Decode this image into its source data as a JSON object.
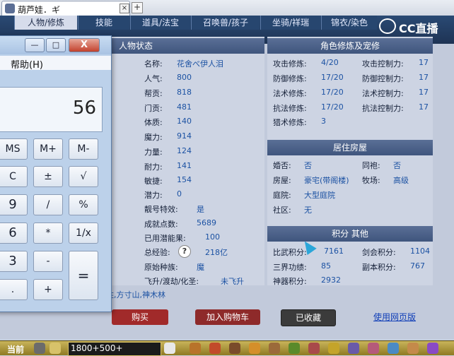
{
  "browser": {
    "tab_title": "葫芦娃．ギ",
    "close_symbol": "×",
    "new_tab_symbol": "+"
  },
  "game": {
    "tabs": [
      "人物/修炼",
      "技能",
      "道具/法宝",
      "召唤兽/孩子",
      "坐骑/祥瑞",
      "锦衣/染色"
    ],
    "logo_text": "CC直播",
    "status": {
      "header": "人物状态",
      "rows": [
        {
          "label": "名称:",
          "value": "花舍べ伊人泪"
        },
        {
          "label": "人气:",
          "value": "800"
        },
        {
          "label": "帮贡:",
          "value": "818"
        },
        {
          "label": "门贡:",
          "value": "481"
        },
        {
          "label": "体质:",
          "value": "140"
        },
        {
          "label": "魔力:",
          "value": "914"
        },
        {
          "label": "力量:",
          "value": "124"
        },
        {
          "label": "耐力:",
          "value": "141"
        },
        {
          "label": "敏捷:",
          "value": "154"
        },
        {
          "label": "潜力:",
          "value": "0"
        },
        {
          "label": "靓号特效:",
          "value": "是"
        },
        {
          "label": "成就点数:",
          "value": "5689"
        },
        {
          "label": "已用潜能果:",
          "value": "100"
        },
        {
          "label": "总经验:",
          "value": "218亿"
        },
        {
          "label": "原始种族:",
          "value": "魔"
        },
        {
          "label": "飞升/渡劫/化圣:",
          "value": "未飞升"
        }
      ],
      "footer": "胜,方寸山,神木林",
      "help_symbol": "?"
    },
    "practice": {
      "header": "角色修炼及宠修",
      "rows": [
        {
          "l1": "攻击修炼:",
          "v1": "4/20",
          "l2": "攻击控制力:",
          "v2": "17"
        },
        {
          "l1": "防御修炼:",
          "v1": "17/20",
          "l2": "防御控制力:",
          "v2": "17"
        },
        {
          "l1": "法术修炼:",
          "v1": "17/20",
          "l2": "法术控制力:",
          "v2": "17"
        },
        {
          "l1": "抗法修炼:",
          "v1": "17/20",
          "l2": "抗法控制力:",
          "v2": "17"
        },
        {
          "l1": "猎术修炼:",
          "v1": "3",
          "l2": "",
          "v2": ""
        }
      ]
    },
    "house": {
      "header": "居住房屋",
      "rows": [
        {
          "l1": "婚否:",
          "v1": "否",
          "l2": "同袍:",
          "v2": "否"
        },
        {
          "l1": "房屋:",
          "v1": "豪宅(带阁楼)",
          "l2": "牧场:",
          "v2": "高级"
        },
        {
          "l1": "庭院:",
          "v1": "大型庭院",
          "l2": "",
          "v2": ""
        },
        {
          "l1": "社区:",
          "v1": "无",
          "l2": "",
          "v2": ""
        }
      ]
    },
    "points": {
      "header": "积分 其他",
      "rows": [
        {
          "l1": "比武积分:",
          "v1": "7161",
          "l2": "剑会积分:",
          "v2": "1104"
        },
        {
          "l1": "三界功绩:",
          "v1": "85",
          "l2": "副本积分:",
          "v2": "767"
        },
        {
          "l1": "神器积分:",
          "v1": "2932",
          "l2": "",
          "v2": ""
        }
      ]
    },
    "buttons": {
      "buy": "购买",
      "cart": "加入购物车",
      "fav": "已收藏",
      "web": "使用网页版"
    }
  },
  "calculator": {
    "menu_help": "帮助(H)",
    "menu_left": ")",
    "display": "56",
    "min_symbol": "—",
    "max_symbol": "□",
    "close_symbol": "X",
    "keys": [
      [
        "MS",
        "M+",
        "M-"
      ],
      [
        "C",
        "±",
        "√"
      ],
      [
        "9",
        "/",
        "%"
      ],
      [
        "6",
        "*",
        "1/x"
      ],
      [
        "3",
        "-",
        "="
      ],
      [
        ".",
        "+",
        ""
      ]
    ]
  },
  "statusbar": {
    "current": "当前",
    "input_text": "1800+500+"
  }
}
